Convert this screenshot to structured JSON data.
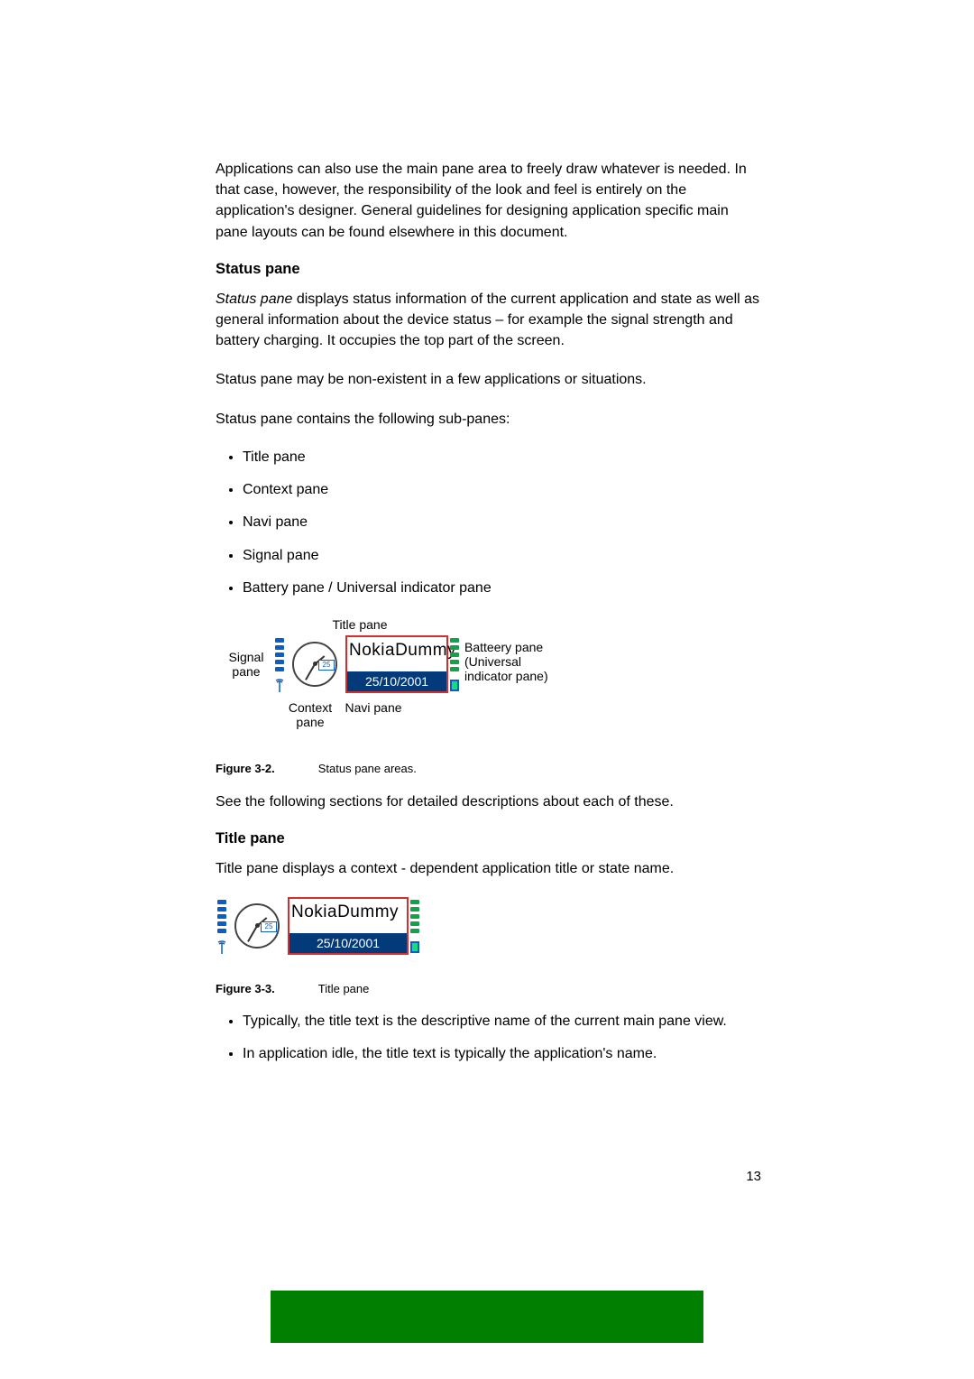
{
  "intro_para": "Applications can also use the main pane area to freely draw whatever is needed. In that case, however, the responsibility of the look and feel is entirely on the application's designer. General guidelines for designing application specific main pane layouts can be found elsewhere in this document.",
  "status_pane": {
    "heading": "Status pane",
    "para1_lead": "Status pane",
    "para1_rest": " displays status information of the current application and state as well as general information about the device status – for example the signal strength and battery charging. It occupies the top part of the screen.",
    "para2": "Status pane may be non-existent in a few applications or situations.",
    "para3": "Status pane contains the following sub-panes:",
    "bullets": [
      "Title pane",
      "Context pane",
      "Navi pane",
      "Signal pane",
      "Battery pane / Universal indicator pane"
    ]
  },
  "fig32": {
    "labels": {
      "signal": "Signal\npane",
      "title": "Title pane",
      "battery": "Batteery  pane\n(Universal\nindicator pane)",
      "context": "Context\npane",
      "navi": "Navi pane"
    },
    "device": {
      "title_text": "NokiaDummy",
      "navi_text": "25/10/2001",
      "clock_small": "25"
    },
    "caption_no": "Figure 3-2.",
    "caption_text": "Status pane areas."
  },
  "fig32_after": "See the following sections for detailed descriptions about each of these.",
  "title_pane": {
    "heading": "Title pane",
    "para": "Title pane displays a context - dependent application title or state name."
  },
  "fig33": {
    "device": {
      "title_text": "NokiaDummy",
      "navi_text": "25/10/2001",
      "clock_small": "25"
    },
    "caption_no": "Figure 3-3.",
    "caption_text": "Title pane",
    "bullets": [
      "Typically, the title text is the descriptive name of the current main pane view.",
      "In application idle, the title text is typically the application's name."
    ]
  },
  "page_number": "13"
}
